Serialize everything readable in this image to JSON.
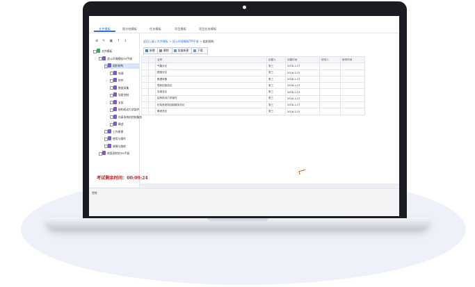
{
  "tabs": [
    "文件模板",
    "图文档模板",
    "任务模板",
    "项目模板",
    "项目任务模板"
  ],
  "tree": {
    "toolbar_glyphs": "⊕ ✎ ▣ ↑ ↓",
    "nodes": [
      {
        "label": "文件模板",
        "level": 0,
        "icon_color": "#3aa84b"
      },
      {
        "label": "战斗环境模拟TM手册",
        "level": 1,
        "icon_color": "#7d55d9"
      },
      {
        "label": "组织结构",
        "level": 2,
        "icon_color": "#7d55d9",
        "selected": true
      },
      {
        "label": "电源",
        "level": 3,
        "icon_color": "#7d55d9"
      },
      {
        "label": "附件",
        "level": 3,
        "icon_color": "#7d55d9"
      },
      {
        "label": "数据采集",
        "level": 3,
        "icon_color": "#7d55d9"
      },
      {
        "label": "导航控制",
        "level": 3,
        "icon_color": "#7d55d9"
      },
      {
        "label": "支架",
        "level": 3,
        "icon_color": "#7d55d9"
      },
      {
        "label": "结构机动力学部件",
        "level": 3,
        "icon_color": "#7d55d9"
      },
      {
        "label": "仿真系统机控制服务",
        "level": 3,
        "icon_color": "#7d55d9"
      },
      {
        "label": "概述",
        "level": 3,
        "icon_color": "#7d55d9"
      },
      {
        "label": "工作原理",
        "level": 2,
        "icon_color": "#7d55d9"
      },
      {
        "label": "使用与操作",
        "level": 2,
        "icon_color": "#7d55d9"
      },
      {
        "label": "故障与维修",
        "level": 2,
        "icon_color": "#7d55d9"
      },
      {
        "label": "地面发射机TM手册",
        "level": 1,
        "icon_color": "#7d55d9"
      }
    ]
  },
  "breadcrumb": {
    "items": [
      "返回上级",
      "文件模板",
      "战斗环境模拟TM手册"
    ],
    "current": "组织结构",
    "sep": " | ",
    "sep2": " > "
  },
  "toolbar": {
    "new": "新增",
    "delete": "删除",
    "batch_new": "批量新建",
    "download": "下载"
  },
  "grid": {
    "columns": [
      "",
      "",
      "名称",
      "创建人",
      "创建时间",
      "修改人",
      "修改时间"
    ],
    "rows": [
      [
        "气路分论",
        "张三",
        "2018-2-27"
      ],
      [
        "图液分论",
        "张三",
        "2018-2-27"
      ],
      [
        "数据采集",
        "张三",
        "2018-2-27"
      ],
      [
        "导航控制总论",
        "张三",
        "2018-2-27"
      ],
      [
        "支架总论",
        "张三",
        "2018-2-27"
      ],
      [
        "结构机动力学部件",
        "张三",
        "2018-2-27"
      ],
      [
        "仿真系统机控制服务总论",
        "张三",
        "2018-2-27"
      ],
      [
        "概述总论",
        "张三",
        "2018-2-27"
      ]
    ]
  },
  "timer": "考试剩余时间：00:09:24",
  "status": "就绪"
}
